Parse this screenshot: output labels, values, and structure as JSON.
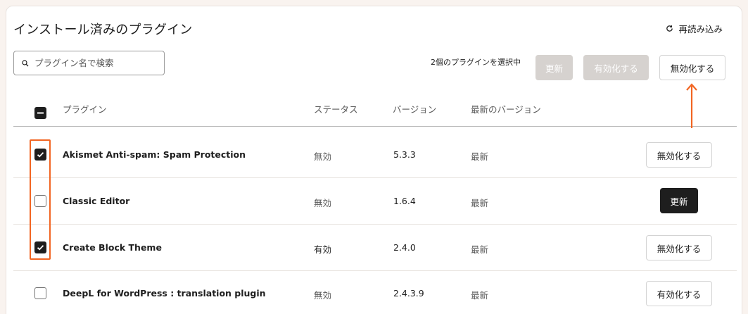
{
  "header": {
    "title": "インストール済みのプラグイン",
    "reload_label": "再読み込み"
  },
  "search": {
    "placeholder": "プラグイン名で検索",
    "value": ""
  },
  "bulk": {
    "selected_text": "2個のプラグインを選択中",
    "update_label": "更新",
    "activate_label": "有効化する",
    "deactivate_label": "無効化する"
  },
  "table": {
    "columns": [
      "プラグイン",
      "ステータス",
      "バージョン",
      "最新のバージョン"
    ],
    "rows": [
      {
        "name": "Akismet Anti-spam: Spam Protection",
        "status": "無効",
        "version": "5.3.3",
        "latest": "最新",
        "action": "無効化する",
        "checked": true
      },
      {
        "name": "Classic Editor",
        "status": "無効",
        "version": "1.6.4",
        "latest": "最新",
        "action": "更新",
        "checked": false
      },
      {
        "name": "Create Block Theme",
        "status": "有効",
        "version": "2.4.0",
        "latest": "最新",
        "action": "無効化する",
        "checked": true
      },
      {
        "name": "DeepL for WordPress : translation plugin",
        "status": "無効",
        "version": "2.4.3.9",
        "latest": "最新",
        "action": "有効化する",
        "checked": false
      }
    ]
  },
  "colors": {
    "accent_orange": "#f26522",
    "dark": "#1e1e1e",
    "disabled_button": "#d6d2cf"
  },
  "icons": {
    "reload": "reload-icon",
    "search": "search-icon",
    "checkbox_checked": "checkmark-icon",
    "checkbox_indeterminate": "minus-icon",
    "arrow": "arrow-up-icon"
  }
}
